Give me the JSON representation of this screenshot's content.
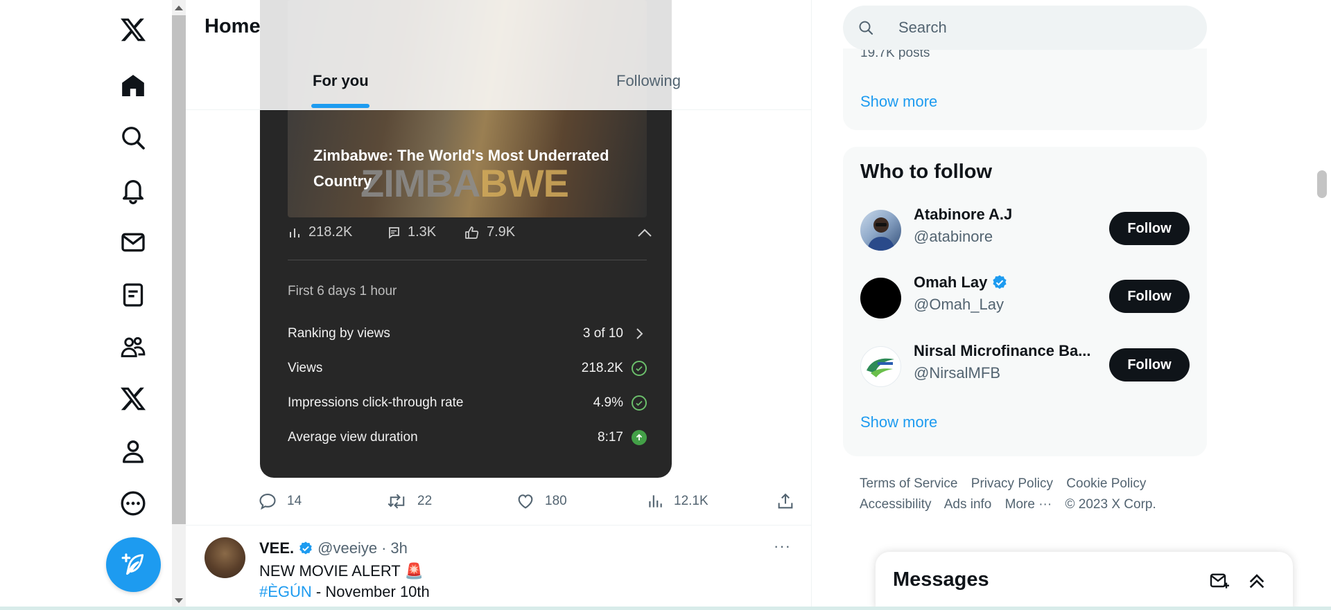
{
  "nav": {
    "items": [
      {
        "icon": "x-logo-icon"
      },
      {
        "icon": "home-icon"
      },
      {
        "icon": "search-icon"
      },
      {
        "icon": "bell-icon"
      },
      {
        "icon": "envelope-icon"
      },
      {
        "icon": "list-icon"
      },
      {
        "icon": "communities-icon"
      },
      {
        "icon": "x-premium-icon"
      },
      {
        "icon": "profile-icon"
      },
      {
        "icon": "more-circle-icon"
      }
    ],
    "post_button_icon": "feather-plus-icon"
  },
  "header": {
    "title": "Home",
    "tabs": [
      {
        "label": "For you",
        "active": true
      },
      {
        "label": "Following",
        "active": false
      }
    ]
  },
  "card": {
    "video": {
      "title": "Zimbabwe: The World's Most Underrated Country",
      "wordmark_a": "ZIMBA",
      "wordmark_b": "BWE"
    },
    "stats": {
      "views": "218.2K",
      "comments": "1.3K",
      "likes": "7.9K"
    },
    "period": "First 6 days 1 hour",
    "metrics": [
      {
        "label": "Ranking by views",
        "value": "3 of 10",
        "indicator": "chevron-right"
      },
      {
        "label": "Views",
        "value": "218.2K",
        "indicator": "check"
      },
      {
        "label": "Impressions click-through rate",
        "value": "4.9%",
        "indicator": "check"
      },
      {
        "label": "Average view duration",
        "value": "8:17",
        "indicator": "arrow-up"
      }
    ]
  },
  "tweet_actions": {
    "replies": "14",
    "reposts": "22",
    "likes": "180",
    "views": "12.1K"
  },
  "next_tweet": {
    "name": "VEE.",
    "handle": "@veeiye",
    "dot": "·",
    "time": "3h",
    "line1": "NEW MOVIE ALERT 🚨",
    "hashtag": "#ÈGÚN",
    "line2_rest": " - November 10th",
    "more": "···"
  },
  "search": {
    "placeholder": "Search"
  },
  "trends": {
    "count_text": "19.7K posts",
    "show_more": "Show more"
  },
  "who_to_follow": {
    "title": "Who to follow",
    "users": [
      {
        "name": "Atabinore A.J",
        "handle": "@atabinore",
        "verified": false,
        "button": "Follow"
      },
      {
        "name": "Omah Lay",
        "handle": "@Omah_Lay",
        "verified": true,
        "button": "Follow"
      },
      {
        "name": "Nirsal Microfinance Ba...",
        "handle": "@NirsalMFB",
        "verified": false,
        "button": "Follow"
      }
    ],
    "show_more": "Show more"
  },
  "footer": {
    "links": [
      "Terms of Service",
      "Privacy Policy",
      "Cookie Policy",
      "Accessibility",
      "Ads info",
      "More ···"
    ],
    "copyright": "© 2023 X Corp."
  },
  "messages": {
    "title": "Messages"
  },
  "colors": {
    "accent": "#1d9bf0",
    "text": "#0f1419",
    "muted": "#536471",
    "card_bg": "#272727",
    "panel_bg": "#f7f9f9"
  }
}
